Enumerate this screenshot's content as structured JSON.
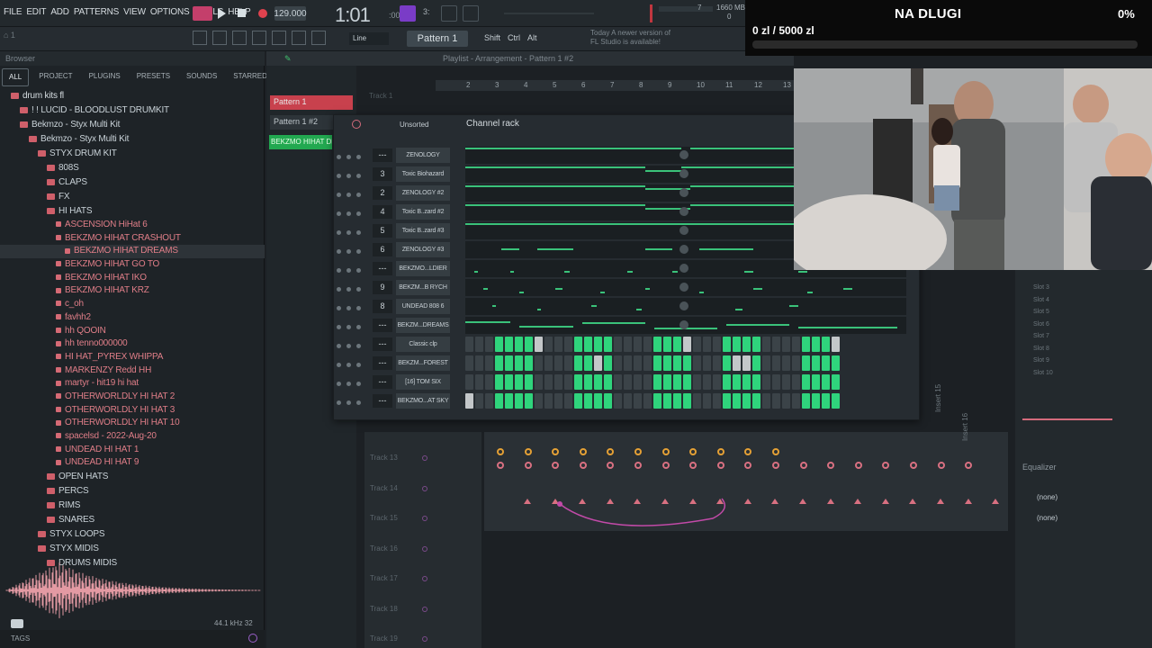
{
  "menu": [
    "FILE",
    "EDIT",
    "ADD",
    "PATTERNS",
    "VIEW",
    "OPTIONS",
    "TOOLS",
    "HELP"
  ],
  "transport": {
    "tempo": "129.000",
    "time": "1:01",
    "time_sub": ":00",
    "cpu": "1660 MB",
    "cpu2": "0",
    "pattern_button": "Pattern 1",
    "snap": "Line",
    "news": "Today  A newer version of FL Studio is available!",
    "beats": "7"
  },
  "browser": {
    "title": "Browser",
    "tabs": [
      "ALL",
      "PROJECT",
      "PLUGINS",
      "PRESETS",
      "SOUNDS",
      "STARRED"
    ],
    "tree": [
      {
        "label": "drum kits fl",
        "depth": 0,
        "type": "folder"
      },
      {
        "label": "! ! LUCID - BLOODLUST DRUMKIT",
        "depth": 1,
        "type": "folder"
      },
      {
        "label": "Bekmzo - Styx Multi Kit",
        "depth": 1,
        "type": "folder"
      },
      {
        "label": "Bekmzo - Styx Multi Kit",
        "depth": 2,
        "type": "folder"
      },
      {
        "label": "STYX DRUM KIT",
        "depth": 3,
        "type": "folder"
      },
      {
        "label": "808S",
        "depth": 4,
        "type": "folder"
      },
      {
        "label": "CLAPS",
        "depth": 4,
        "type": "folder"
      },
      {
        "label": "FX",
        "depth": 4,
        "type": "folder"
      },
      {
        "label": "HI HATS",
        "depth": 4,
        "type": "folder"
      },
      {
        "label": "ASCENSION HiHat 6",
        "depth": 5,
        "type": "file"
      },
      {
        "label": "BEKZMO HIHAT CRASHOUT",
        "depth": 5,
        "type": "file"
      },
      {
        "label": "BEKZMO HIHAT DREAMS",
        "depth": 6,
        "type": "file",
        "selected": true
      },
      {
        "label": "BEKZMO HIHAT GO TO",
        "depth": 5,
        "type": "file"
      },
      {
        "label": "BEKZMO HIHAT IKO",
        "depth": 5,
        "type": "file"
      },
      {
        "label": "BEKZMO HIHAT KRZ",
        "depth": 5,
        "type": "file"
      },
      {
        "label": "c_oh",
        "depth": 5,
        "type": "file"
      },
      {
        "label": "favhh2",
        "depth": 5,
        "type": "file"
      },
      {
        "label": "hh QOOIN",
        "depth": 5,
        "type": "file"
      },
      {
        "label": "hh tenno000000",
        "depth": 5,
        "type": "file"
      },
      {
        "label": "HI HAT_PYREX WHIPPA",
        "depth": 5,
        "type": "file"
      },
      {
        "label": "MARKENZY Redd HH",
        "depth": 5,
        "type": "file"
      },
      {
        "label": "martyr - hit19 hi hat",
        "depth": 5,
        "type": "file"
      },
      {
        "label": "OTHERWORLDLY HI HAT 2",
        "depth": 5,
        "type": "file"
      },
      {
        "label": "OTHERWORLDLY HI HAT 3",
        "depth": 5,
        "type": "file"
      },
      {
        "label": "OTHERWORLDLY HI HAT 10",
        "depth": 5,
        "type": "file"
      },
      {
        "label": "spacelsd - 2022-Aug-20",
        "depth": 5,
        "type": "file"
      },
      {
        "label": "UNDEAD HI HAT 1",
        "depth": 5,
        "type": "file"
      },
      {
        "label": "UNDEAD HI HAT 9",
        "depth": 5,
        "type": "file"
      },
      {
        "label": "OPEN HATS",
        "depth": 4,
        "type": "folder"
      },
      {
        "label": "PERCS",
        "depth": 4,
        "type": "folder"
      },
      {
        "label": "RIMS",
        "depth": 4,
        "type": "folder"
      },
      {
        "label": "SNARES",
        "depth": 4,
        "type": "folder"
      },
      {
        "label": "STYX LOOPS",
        "depth": 3,
        "type": "folder"
      },
      {
        "label": "STYX MIDIS",
        "depth": 3,
        "type": "folder"
      },
      {
        "label": "DRUMS MIDIS",
        "depth": 4,
        "type": "folder"
      }
    ],
    "sample_info": "44.1 kHz 32",
    "tags": "TAGS"
  },
  "playlist": {
    "title": "Playlist - Arrangement - Pattern 1 #2",
    "patterns": [
      "Pattern 1",
      "Pattern 1 #2"
    ],
    "clip": "BEKZMO HIHAT DREAMS",
    "ruler": [
      "2",
      "3",
      "4",
      "5",
      "6",
      "7",
      "8",
      "9",
      "10",
      "11",
      "12",
      "13"
    ],
    "tracks": [
      "Track 13",
      "Track 14",
      "Track 15",
      "Track 16",
      "Track 17",
      "Track 18",
      "Track 19"
    ],
    "track_top": "Track 1"
  },
  "channel_rack": {
    "title": "Channel rack",
    "filter": "Unsorted",
    "channels": [
      {
        "num": "---",
        "name": "ZENOLOGY",
        "mode": "roll"
      },
      {
        "num": "3",
        "name": "Toxic Biohazard",
        "mode": "roll"
      },
      {
        "num": "2",
        "name": "ZENOLOGY #2",
        "mode": "roll"
      },
      {
        "num": "4",
        "name": "Toxic B..zard #2",
        "mode": "roll"
      },
      {
        "num": "5",
        "name": "Toxic B..zard #3",
        "mode": "roll"
      },
      {
        "num": "6",
        "name": "ZENOLOGY #3",
        "mode": "roll"
      },
      {
        "num": "---",
        "name": "BEKZMO...LDIER",
        "mode": "roll"
      },
      {
        "num": "9",
        "name": "BEKZM...B RYCH",
        "mode": "roll"
      },
      {
        "num": "8",
        "name": "UNDEAD 808 6",
        "mode": "roll"
      },
      {
        "num": "---",
        "name": "BEKZM...DREAMS",
        "mode": "roll"
      },
      {
        "num": "---",
        "name": "Classic clp",
        "mode": "steps",
        "steps": [
          0,
          0,
          0,
          1,
          1,
          1,
          1,
          2,
          0,
          0,
          0,
          1,
          1,
          1,
          1,
          0,
          0,
          0,
          0,
          1,
          1,
          1,
          2,
          0,
          0,
          0,
          1,
          1,
          1,
          1,
          0,
          0,
          0,
          0,
          1,
          1,
          1,
          2
        ]
      },
      {
        "num": "---",
        "name": "BEKZM...FOREST",
        "mode": "steps",
        "steps": [
          0,
          0,
          0,
          1,
          1,
          1,
          1,
          0,
          0,
          0,
          0,
          1,
          1,
          2,
          1,
          0,
          0,
          0,
          0,
          1,
          1,
          1,
          1,
          0,
          0,
          0,
          1,
          2,
          2,
          1,
          0,
          0,
          0,
          0,
          1,
          1,
          1,
          1
        ]
      },
      {
        "num": "---",
        "name": "[16] TOM SIX",
        "mode": "steps",
        "steps": [
          0,
          0,
          0,
          1,
          1,
          1,
          1,
          0,
          0,
          0,
          0,
          1,
          1,
          1,
          1,
          0,
          0,
          0,
          0,
          1,
          1,
          1,
          1,
          0,
          0,
          0,
          1,
          1,
          1,
          1,
          0,
          0,
          0,
          0,
          1,
          1,
          1,
          1
        ]
      },
      {
        "num": "---",
        "name": "BEKZMO...AT SKY",
        "mode": "steps",
        "steps": [
          2,
          0,
          0,
          1,
          1,
          1,
          1,
          0,
          0,
          0,
          0,
          1,
          1,
          1,
          1,
          0,
          0,
          0,
          0,
          1,
          1,
          1,
          1,
          0,
          0,
          0,
          1,
          1,
          1,
          1,
          0,
          0,
          0,
          0,
          1,
          1,
          1,
          1
        ]
      }
    ]
  },
  "mixer": {
    "inserts": [
      "Insert 15",
      "Insert 16"
    ],
    "slots": [
      "Slot 3",
      "Slot 4",
      "Slot 5",
      "Slot 6",
      "Slot 7",
      "Slot 8",
      "Slot 9",
      "Slot 10"
    ],
    "eq": "Equalizer",
    "none1": "(none)",
    "none2": "(none)"
  },
  "overlay": {
    "title": "NA DLUGI",
    "amount": "0 zl / 5000 zl",
    "percent": "0%",
    "progress": 0
  },
  "colors": {
    "accent": "#c8414d",
    "step_on": "#2fd47c",
    "knob": "#e4a035"
  }
}
